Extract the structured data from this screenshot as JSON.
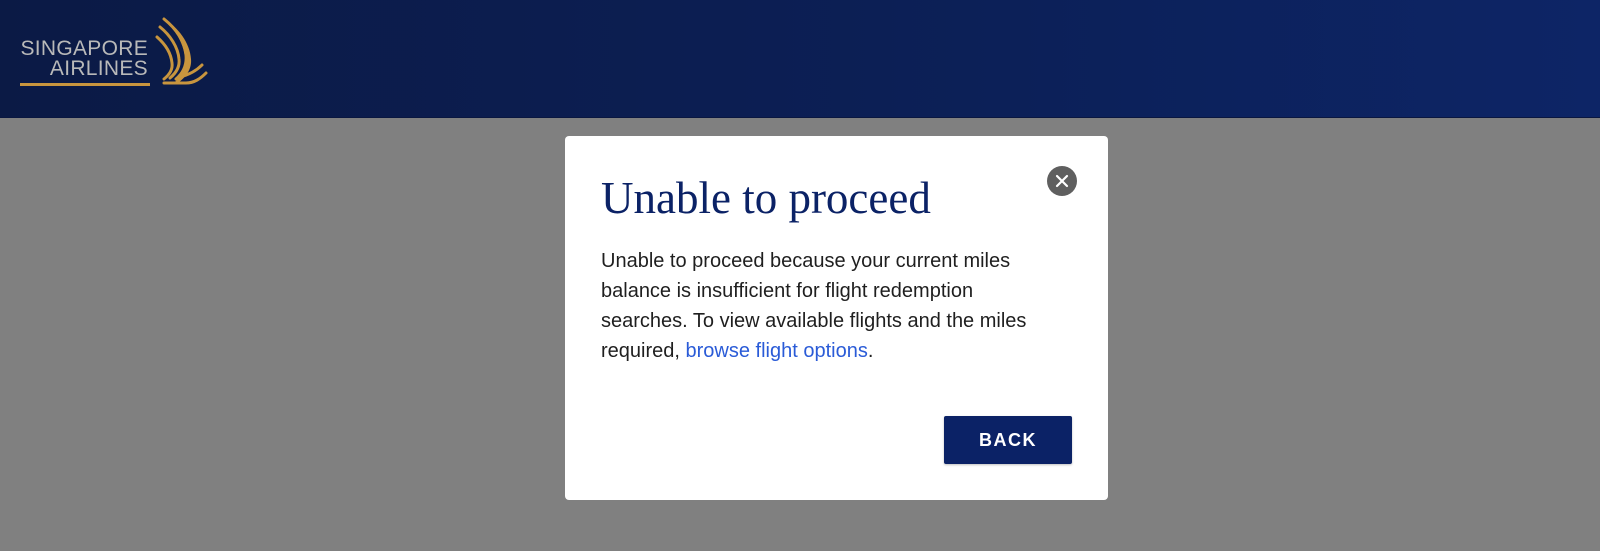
{
  "header": {
    "logo": {
      "line1": "SINGAPORE",
      "line2": "AIRLINES",
      "icon": "singapore-airlines-bird-logo",
      "gold_color": "#c8953e"
    },
    "background_color": "#0c1f55"
  },
  "modal": {
    "title": "Unable to proceed",
    "body_text": "Unable to proceed because your current miles balance is insufficient for flight redemption searches. To view available flights and the miles required, ",
    "link_text": "browse flight options",
    "body_suffix": ".",
    "close_icon": "close-icon",
    "back_label": "BACK",
    "accent_color": "#0b2266",
    "link_color": "#2a5bd7"
  },
  "overlay_color": "#808080"
}
